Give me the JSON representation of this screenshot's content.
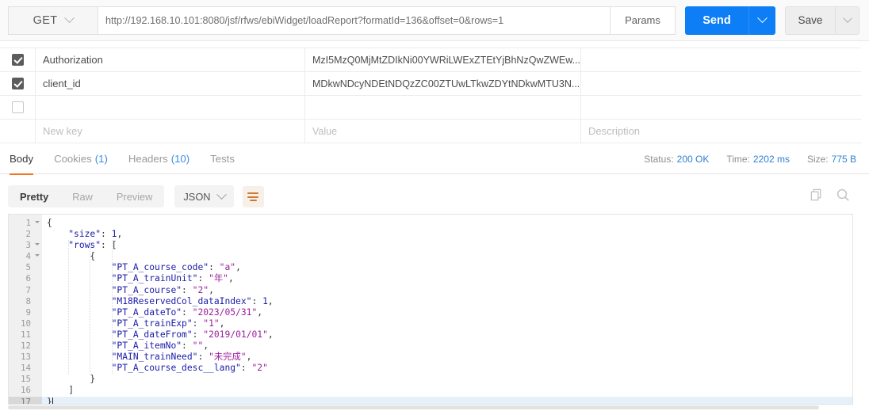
{
  "request": {
    "method": "GET",
    "url": "http://192.168.10.101:8080/jsf/rfws/ebiWidget/loadReport?formatId=136&offset=0&rows=1",
    "params_label": "Params",
    "send_label": "Send",
    "save_label": "Save"
  },
  "headers_table": {
    "placeholder_key": "New key",
    "placeholder_value": "Value",
    "placeholder_desc": "Description",
    "rows": [
      {
        "checked": true,
        "key": "Authorization",
        "value": "MzI5MzQ0MjMtZDIkNi00YWRiLWExZTEtYjBhNzQwZWEw...",
        "desc": ""
      },
      {
        "checked": true,
        "key": "client_id",
        "value": "MDkwNDcyNDEtNDQzZC00ZTUwLTkwZDYtNDkwMTU3N...",
        "desc": ""
      },
      {
        "checked": false,
        "key": "",
        "value": "",
        "desc": ""
      }
    ]
  },
  "response_tabs": [
    {
      "label": "Body",
      "count": "",
      "active": true
    },
    {
      "label": "Cookies",
      "count": "(1)",
      "active": false
    },
    {
      "label": "Headers",
      "count": "(10)",
      "active": false
    },
    {
      "label": "Tests",
      "count": "",
      "active": false
    }
  ],
  "status": {
    "status_label": "Status:",
    "status_value": "200 OK",
    "time_label": "Time:",
    "time_value": "2202 ms",
    "size_label": "Size:",
    "size_value": "775 B"
  },
  "view_toolbar": {
    "modes": [
      {
        "label": "Pretty",
        "active": true
      },
      {
        "label": "Raw",
        "active": false
      },
      {
        "label": "Preview",
        "active": false
      }
    ],
    "format": "JSON",
    "wrap_icon": "word-wrap-icon",
    "copy_icon": "copy-icon",
    "search_icon": "search-icon"
  },
  "colors": {
    "accent_orange": "#ef7622",
    "send_blue": "#0d7ef5",
    "status_blue": "#2f7fd4",
    "json_key": "#1b1ba8",
    "json_string": "#9b1f9b",
    "gutter_bg": "#f0f0f0",
    "active_line": "#e6f0fb"
  },
  "editor": {
    "total_lines": 17,
    "current_line": 17,
    "fold_lines": [
      1,
      3,
      4
    ],
    "lines": [
      {
        "n": 1,
        "indent": 0,
        "tokens": [
          {
            "t": "punct",
            "v": "{"
          }
        ]
      },
      {
        "n": 2,
        "indent": 1,
        "tokens": [
          {
            "t": "key",
            "v": "\"size\""
          },
          {
            "t": "punct",
            "v": ": "
          },
          {
            "t": "num",
            "v": "1"
          },
          {
            "t": "punct",
            "v": ","
          }
        ]
      },
      {
        "n": 3,
        "indent": 1,
        "tokens": [
          {
            "t": "key",
            "v": "\"rows\""
          },
          {
            "t": "punct",
            "v": ": ["
          }
        ]
      },
      {
        "n": 4,
        "indent": 2,
        "tokens": [
          {
            "t": "punct",
            "v": "{"
          }
        ]
      },
      {
        "n": 5,
        "indent": 3,
        "tokens": [
          {
            "t": "key",
            "v": "\"PT_A_course_code\""
          },
          {
            "t": "punct",
            "v": ": "
          },
          {
            "t": "str",
            "v": "\"a\""
          },
          {
            "t": "punct",
            "v": ","
          }
        ]
      },
      {
        "n": 6,
        "indent": 3,
        "tokens": [
          {
            "t": "key",
            "v": "\"PT_A_trainUnit\""
          },
          {
            "t": "punct",
            "v": ": "
          },
          {
            "t": "str",
            "v": "\"年\""
          },
          {
            "t": "punct",
            "v": ","
          }
        ]
      },
      {
        "n": 7,
        "indent": 3,
        "tokens": [
          {
            "t": "key",
            "v": "\"PT_A_course\""
          },
          {
            "t": "punct",
            "v": ": "
          },
          {
            "t": "str",
            "v": "\"2\""
          },
          {
            "t": "punct",
            "v": ","
          }
        ]
      },
      {
        "n": 8,
        "indent": 3,
        "tokens": [
          {
            "t": "key",
            "v": "\"M18ReservedCol_dataIndex\""
          },
          {
            "t": "punct",
            "v": ": "
          },
          {
            "t": "num",
            "v": "1"
          },
          {
            "t": "punct",
            "v": ","
          }
        ]
      },
      {
        "n": 9,
        "indent": 3,
        "tokens": [
          {
            "t": "key",
            "v": "\"PT_A_dateTo\""
          },
          {
            "t": "punct",
            "v": ": "
          },
          {
            "t": "str",
            "v": "\"2023/05/31\""
          },
          {
            "t": "punct",
            "v": ","
          }
        ]
      },
      {
        "n": 10,
        "indent": 3,
        "tokens": [
          {
            "t": "key",
            "v": "\"PT_A_trainExp\""
          },
          {
            "t": "punct",
            "v": ": "
          },
          {
            "t": "str",
            "v": "\"1\""
          },
          {
            "t": "punct",
            "v": ","
          }
        ]
      },
      {
        "n": 11,
        "indent": 3,
        "tokens": [
          {
            "t": "key",
            "v": "\"PT_A_dateFrom\""
          },
          {
            "t": "punct",
            "v": ": "
          },
          {
            "t": "str",
            "v": "\"2019/01/01\""
          },
          {
            "t": "punct",
            "v": ","
          }
        ]
      },
      {
        "n": 12,
        "indent": 3,
        "tokens": [
          {
            "t": "key",
            "v": "\"PT_A_itemNo\""
          },
          {
            "t": "punct",
            "v": ": "
          },
          {
            "t": "str",
            "v": "\"\""
          },
          {
            "t": "punct",
            "v": ","
          }
        ]
      },
      {
        "n": 13,
        "indent": 3,
        "tokens": [
          {
            "t": "key",
            "v": "\"MAIN_trainNeed\""
          },
          {
            "t": "punct",
            "v": ": "
          },
          {
            "t": "str",
            "v": "\"未完成\""
          },
          {
            "t": "punct",
            "v": ","
          }
        ]
      },
      {
        "n": 14,
        "indent": 3,
        "tokens": [
          {
            "t": "key",
            "v": "\"PT_A_course_desc__lang\""
          },
          {
            "t": "punct",
            "v": ": "
          },
          {
            "t": "str",
            "v": "\"2\""
          }
        ]
      },
      {
        "n": 15,
        "indent": 2,
        "tokens": [
          {
            "t": "punct",
            "v": "}"
          }
        ]
      },
      {
        "n": 16,
        "indent": 1,
        "tokens": [
          {
            "t": "punct",
            "v": "]"
          }
        ]
      },
      {
        "n": 17,
        "indent": 0,
        "tokens": [
          {
            "t": "punct",
            "v": "}"
          }
        ]
      }
    ]
  },
  "response_json": {
    "size": 1,
    "rows": [
      {
        "PT_A_course_code": "a",
        "PT_A_trainUnit": "年",
        "PT_A_course": "2",
        "M18ReservedCol_dataIndex": 1,
        "PT_A_dateTo": "2023/05/31",
        "PT_A_trainExp": "1",
        "PT_A_dateFrom": "2019/01/01",
        "PT_A_itemNo": "",
        "MAIN_trainNeed": "未完成",
        "PT_A_course_desc__lang": "2"
      }
    ]
  }
}
